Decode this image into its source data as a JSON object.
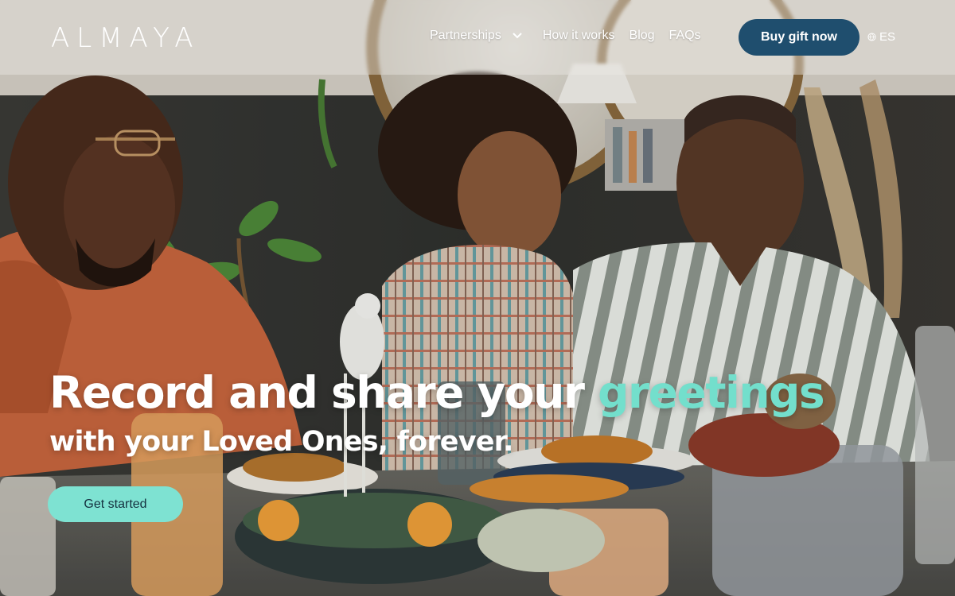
{
  "brand": {
    "logo_text": "ALMAYA"
  },
  "nav": {
    "items": [
      {
        "label": "Partnerships",
        "has_dropdown": true
      },
      {
        "label": "How it works"
      },
      {
        "label": "Blog"
      },
      {
        "label": "FAQs"
      }
    ],
    "buy_button": "Buy gift now",
    "language": "ES",
    "language_icon": "globe-icon",
    "dropdown_icon": "chevron-down-icon"
  },
  "hero": {
    "headline_main": "Record and share your ",
    "headline_accent": "greetings",
    "subheadline": "with your Loved Ones, forever.",
    "cta_label": "Get started",
    "image_alt": "family-dinner-photo"
  },
  "colors": {
    "accent": "#73dfcc",
    "cta_bg": "#7ee2d2",
    "buy_button_bg": "#1f4e6e",
    "header_overlay": "rgba(235,233,228,0.42)"
  }
}
